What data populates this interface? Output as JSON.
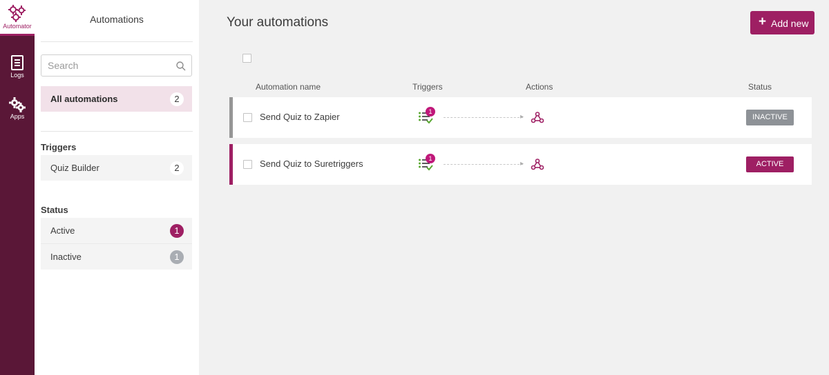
{
  "app": {
    "brand_label": "Automator",
    "nav": [
      {
        "label": "Logs",
        "icon": "document-icon"
      },
      {
        "label": "Apps",
        "icon": "gears-icon"
      }
    ],
    "accent_color": "#9e1f63"
  },
  "sidebar": {
    "title": "Automations",
    "search_placeholder": "Search",
    "all": {
      "label": "All automations",
      "count": "2"
    },
    "triggers_heading": "Triggers",
    "triggers": [
      {
        "label": "Quiz Builder",
        "count": "2"
      }
    ],
    "status_heading": "Status",
    "statuses": [
      {
        "label": "Active",
        "count": "1"
      },
      {
        "label": "Inactive",
        "count": "1"
      }
    ]
  },
  "main": {
    "title": "Your automations",
    "add_button_label": "Add new",
    "columns": {
      "name": "Automation name",
      "triggers": "Triggers",
      "actions": "Actions",
      "status": "Status"
    },
    "rows": [
      {
        "name": "Send Quiz to Zapier",
        "trigger_count": "1",
        "action_icon": "webhook-icon",
        "status": "INACTIVE"
      },
      {
        "name": "Send Quiz to Suretriggers",
        "trigger_count": "1",
        "action_icon": "webhook-icon",
        "status": "ACTIVE"
      }
    ]
  }
}
